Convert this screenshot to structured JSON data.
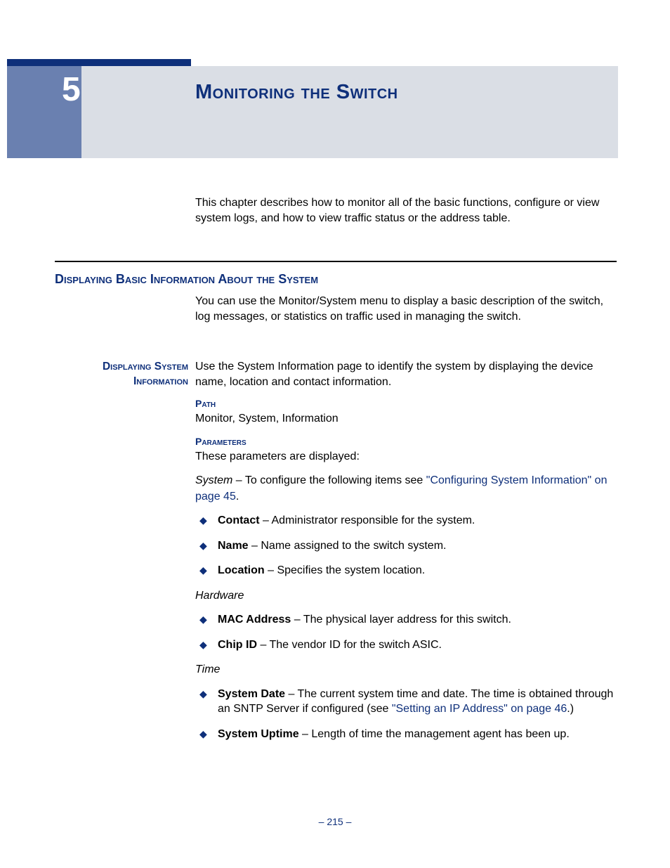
{
  "chapter": {
    "number": "5",
    "title": "Monitoring the Switch"
  },
  "intro": "This chapter describes how to monitor all of the basic functions, configure or view system logs, and how to view traffic status or the address table.",
  "section_heading": "Displaying Basic Information About the System",
  "section_body": "You can use the Monitor/System menu to display a basic description of the switch, log messages, or statistics on traffic used in managing the switch.",
  "subsection_label": "Displaying System Information",
  "subsection_intro": "Use the System Information page to identify the system by displaying the device name, location and contact information.",
  "path_label": "Path",
  "path_value": "Monitor, System, Information",
  "params_label": "Parameters",
  "params_intro": "These parameters are displayed:",
  "system_prefix": "System",
  "system_text": " – To configure the following items see ",
  "system_link": "\"Configuring System Information\" on page 45",
  "system_suffix": ".",
  "system_items": [
    {
      "term": "Contact",
      "desc": " – Administrator responsible for the system."
    },
    {
      "term": "Name",
      "desc": " – Name assigned to the switch system."
    },
    {
      "term": "Location",
      "desc": " – Specifies the system location."
    }
  ],
  "hardware_label": "Hardware",
  "hardware_items": [
    {
      "term": "MAC Address",
      "desc": " – The physical layer address for this switch."
    },
    {
      "term": "Chip ID",
      "desc": " – The vendor ID for the switch ASIC."
    }
  ],
  "time_label": "Time",
  "time_items": [
    {
      "term": "System Date",
      "desc_pre": " – The current system time and date. The time is obtained through an SNTP Server if configured (see ",
      "link": "\"Setting an IP Address\" on page 46",
      "desc_post": ".)"
    },
    {
      "term": "System Uptime",
      "desc": " – Length of time the management agent has been up."
    }
  ],
  "page_number": "–  215  –"
}
